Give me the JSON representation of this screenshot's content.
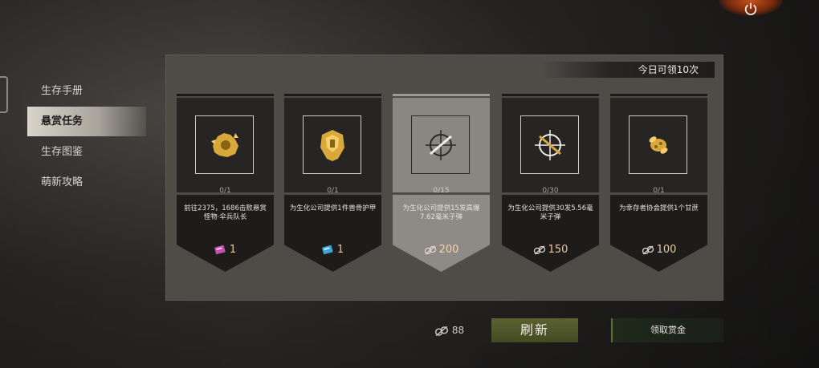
{
  "sidebar": {
    "items": [
      {
        "label": "生存手册",
        "active": false
      },
      {
        "label": "悬赏任务",
        "active": true
      },
      {
        "label": "生存图鉴",
        "active": false
      },
      {
        "label": "萌新攻略",
        "active": false
      }
    ]
  },
  "quota_text": "今日可领10次",
  "cards": [
    {
      "progress": "0/1",
      "description": "前往2375，1686击败悬赏怪物·伞兵队长",
      "reward_icon": "pink-ticket-icon",
      "reward_value": "1",
      "icon": "gold-fist-emblem-icon",
      "selected": false
    },
    {
      "progress": "0/1",
      "description": "为生化公司提供1件兽骨护甲",
      "reward_icon": "blue-ticket-icon",
      "reward_value": "1",
      "icon": "gold-armor-icon",
      "selected": false
    },
    {
      "progress": "0/15",
      "description": "为生化公司提供15发高爆7.62毫米子弹",
      "reward_icon": "bounty-coin-icon",
      "reward_value": "200",
      "icon": "crosshair-rifle-icon",
      "selected": true
    },
    {
      "progress": "0/30",
      "description": "为生化公司提供30发5.56毫米子弹",
      "reward_icon": "bounty-coin-icon",
      "reward_value": "150",
      "icon": "crosshair-rifle-gold-icon",
      "selected": false
    },
    {
      "progress": "0/1",
      "description": "为幸存者协会提供1个甘蔗",
      "reward_icon": "bounty-coin-icon",
      "reward_value": "100",
      "icon": "sugarcane-icon",
      "selected": false
    }
  ],
  "currency": {
    "icon": "bounty-coin-icon",
    "value": "88"
  },
  "buttons": {
    "refresh": "刷新",
    "claim": "领取赏金"
  },
  "colors": {
    "accent_green": "#4e5629",
    "reward_text": "#e9c9a0",
    "gold": "#d9a83a"
  }
}
